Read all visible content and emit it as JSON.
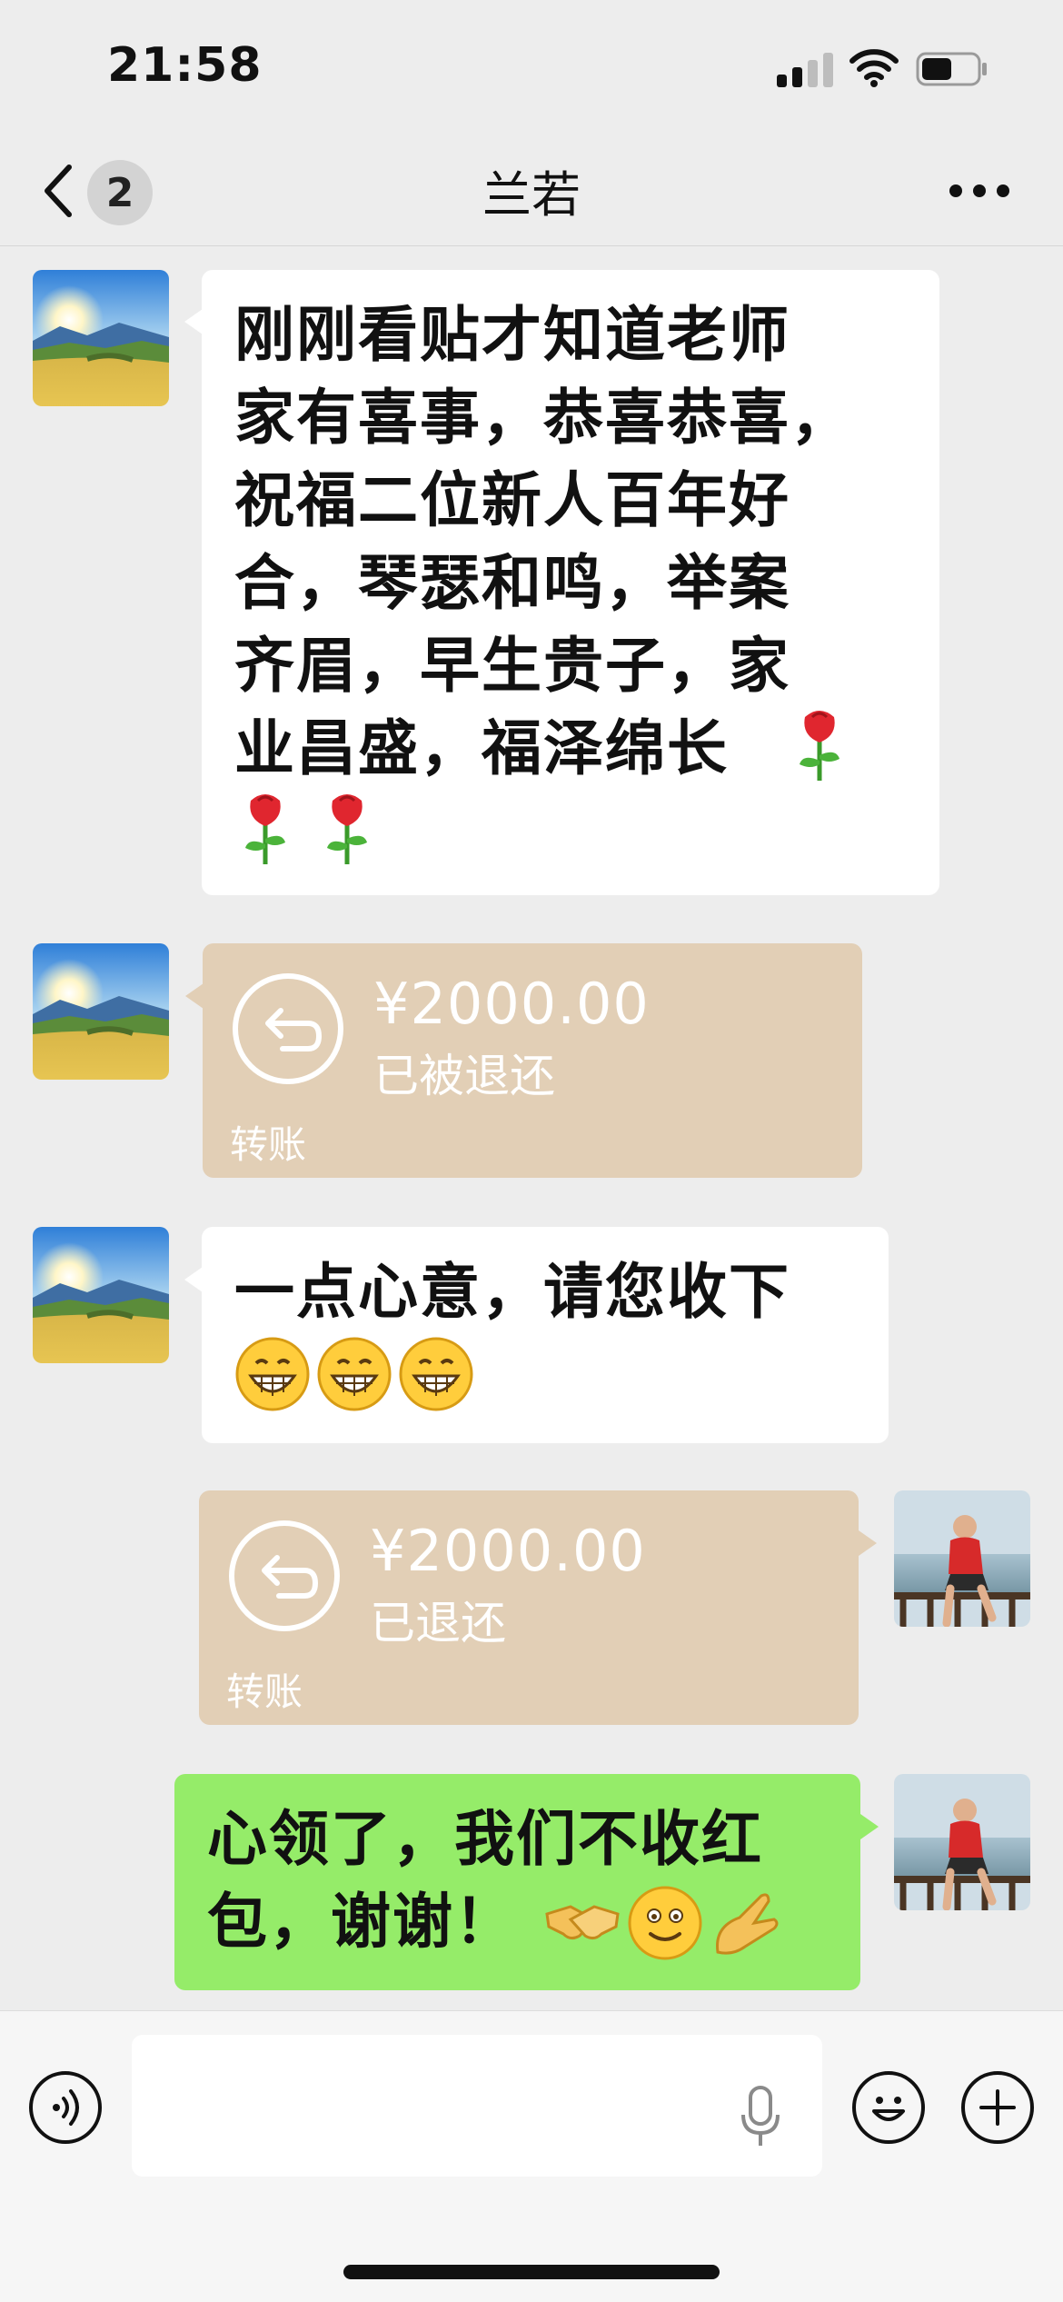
{
  "status_bar": {
    "time": "21:58",
    "battery_level": 0.55
  },
  "nav": {
    "unread_count": "2",
    "title": "兰若"
  },
  "messages": [
    {
      "side": "left",
      "type": "text",
      "text": "刚刚看贴才知道老师\n家有喜事，恭喜恭喜，\n祝福二位新人百年好\n合，琴瑟和鸣，举案\n齐眉，早生贵子，家\n业昌盛，福泽绵长",
      "trailing_emoji": "rose x3"
    },
    {
      "side": "left",
      "type": "transfer",
      "amount": "¥2000.00",
      "state": "已被退还",
      "kind": "转账"
    },
    {
      "side": "left",
      "type": "text",
      "text": "一点心意，请您收下",
      "trailing_emoji": "grin x3"
    },
    {
      "side": "right",
      "type": "transfer",
      "amount": "¥2000.00",
      "state": "已退还",
      "kind": "转账"
    },
    {
      "side": "right",
      "type": "text",
      "text": "心领了，我们不收红\n包，谢谢！",
      "trailing_emoji": "handshake, smile, ok-hand"
    }
  ],
  "colors": {
    "background": "#ededed",
    "incoming_bubble": "#ffffff",
    "outgoing_bubble": "#95ec69",
    "transfer_card": "#e2cfb6"
  }
}
